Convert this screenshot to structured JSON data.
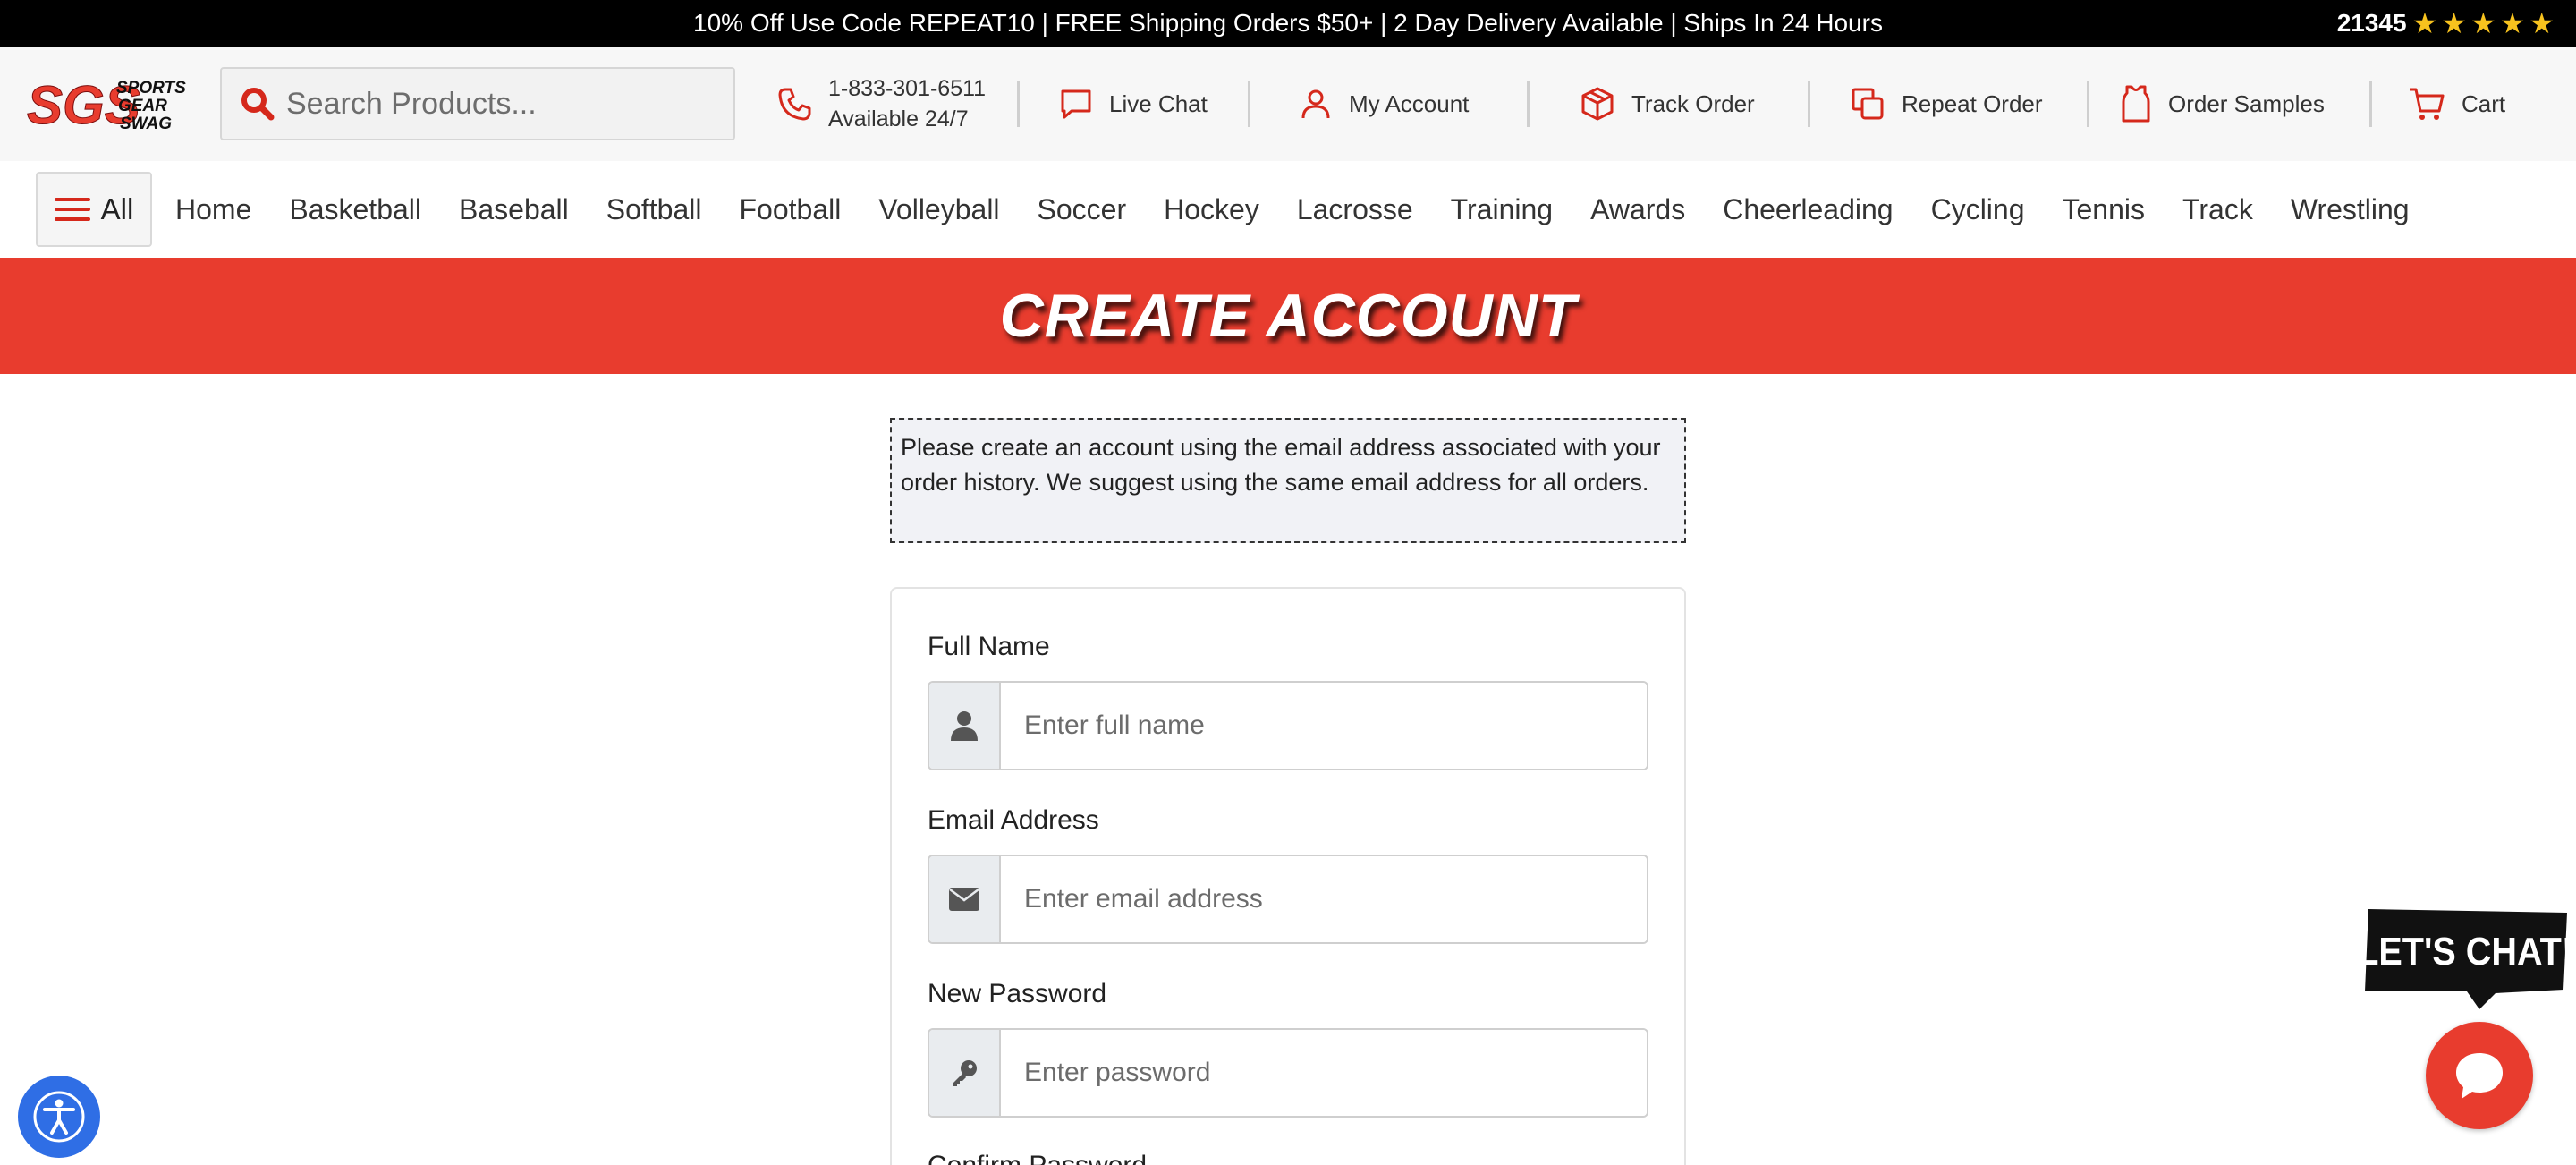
{
  "announcement": {
    "text": "10% Off Use Code REPEAT10 | FREE Shipping Orders $50+ | 2 Day Delivery Available | Ships In 24 Hours",
    "review_count": "21345",
    "star_rating": 5
  },
  "header": {
    "logo_text": [
      "SGS",
      "SPORTS",
      "GEAR",
      "SWAG"
    ],
    "search_placeholder": "Search Products...",
    "phone": {
      "number": "1-833-301-6511",
      "availability": "Available 24/7"
    },
    "live_chat": "Live Chat",
    "my_account": "My Account",
    "track_order": "Track Order",
    "repeat_order": "Repeat Order",
    "order_samples": "Order Samples",
    "cart": "Cart"
  },
  "nav": {
    "all_label": "All",
    "categories": [
      "Home",
      "Basketball",
      "Baseball",
      "Softball",
      "Football",
      "Volleyball",
      "Soccer",
      "Hockey",
      "Lacrosse",
      "Training",
      "Awards",
      "Cheerleading",
      "Cycling",
      "Tennis",
      "Track",
      "Wrestling"
    ]
  },
  "page": {
    "title": "CREATE ACCOUNT",
    "notice": "Please create an account using the email address associated with your order history. We suggest using the same email address for all orders."
  },
  "form": {
    "full_name": {
      "label": "Full Name",
      "placeholder": "Enter full name",
      "icon": "user-icon"
    },
    "email": {
      "label": "Email Address",
      "placeholder": "Enter email address",
      "icon": "envelope-icon"
    },
    "new_password": {
      "label": "New Password",
      "placeholder": "Enter password",
      "icon": "key-icon"
    },
    "confirm_password": {
      "label": "Confirm Password"
    }
  },
  "chat": {
    "bubble_text": "LET'S CHAT!"
  },
  "colors": {
    "brand_red": "#e83c2e",
    "black": "#000000",
    "star_yellow": "#f7c21e",
    "a11y_blue": "#2f6ee5"
  }
}
